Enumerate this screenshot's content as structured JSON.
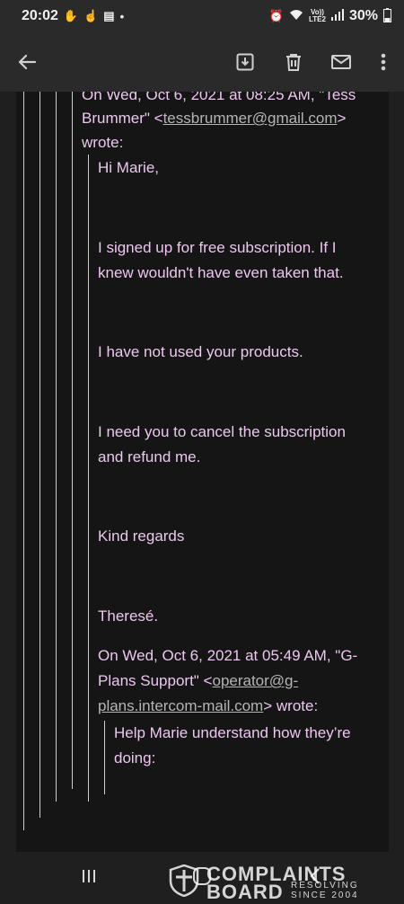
{
  "status_bar": {
    "time": "20:02",
    "battery": "30%",
    "network_top": "Vo))",
    "network_bottom": "LTE2"
  },
  "toolbar": {
    "back_icon": "arrow-left-icon",
    "archive_icon": "archive-icon",
    "delete_icon": "trash-icon",
    "mark_unread_icon": "mail-icon",
    "more_icon": "more-vertical-icon"
  },
  "message": {
    "header_line1": "On Wed, Oct 6, 2021 at 08:25 AM, \"Tess",
    "header_line2_prefix": "Brummer\" <",
    "header_email": "tessbrummer@gmail.com",
    "header_line2_suffix": ">",
    "header_line3": "wrote:",
    "greeting": "Hi Marie,",
    "para1_line1": "I signed up for free subscription. If I",
    "para1_line2": "knew wouldn't have even taken that.",
    "para2": "I have not used your products.",
    "para3_line1": "I need you to cancel the subscription",
    "para3_line2": "and refund me.",
    "closing": "Kind regards",
    "signature": "Theresé.",
    "quote_header_line1": "On Wed, Oct 6, 2021 at 05:49 AM, \"G-",
    "quote_header_line2_prefix": "Plans Support\" <",
    "quote_header_email_part1": "operator@g-",
    "quote_header_email_part2": "plans.intercom-mail.com",
    "quote_header_line3_suffix": "> wrote:",
    "nested_line1": "Help Marie understand how they’re",
    "nested_line2": "doing:"
  },
  "watermark": {
    "word1": "COMPLAINTS",
    "word2": "BOARD",
    "tag1": "RESOLVING",
    "tag2": "SINCE 2004"
  },
  "colors": {
    "bar_bg": "#2a2a2b",
    "quote_bg": "#151516",
    "quote_text": "#ecc7ee",
    "link_text": "#b5b5b5"
  }
}
